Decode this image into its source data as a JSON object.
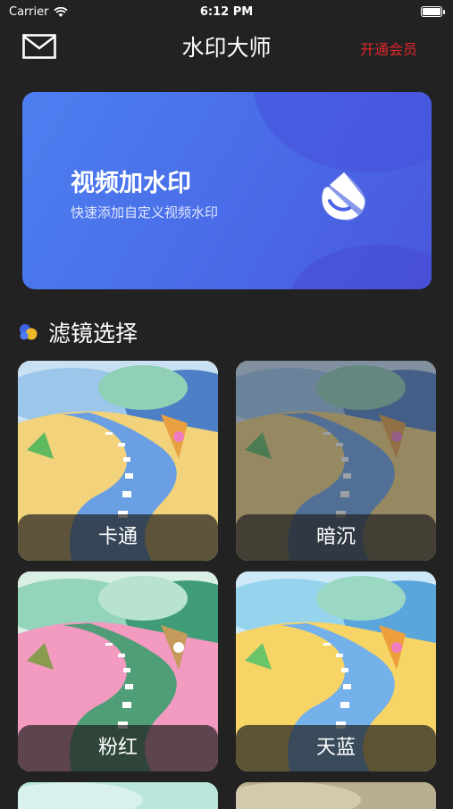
{
  "status": {
    "carrier": "Carrier",
    "time": "6:12 PM"
  },
  "nav": {
    "mail_icon": "mail-icon",
    "title": "水印大师",
    "vip_label": "开通会员",
    "vip_color": "#e0262a"
  },
  "banner": {
    "title": "视频加水印",
    "subtitle": "快速添加自定义视频水印",
    "icon": "watermark-drop-icon"
  },
  "section": {
    "title": "滤镜选择",
    "icon": "color-dots-icon"
  },
  "filters": [
    {
      "label": "卡通"
    },
    {
      "label": "暗沉"
    },
    {
      "label": "粉红"
    },
    {
      "label": "天蓝"
    }
  ]
}
